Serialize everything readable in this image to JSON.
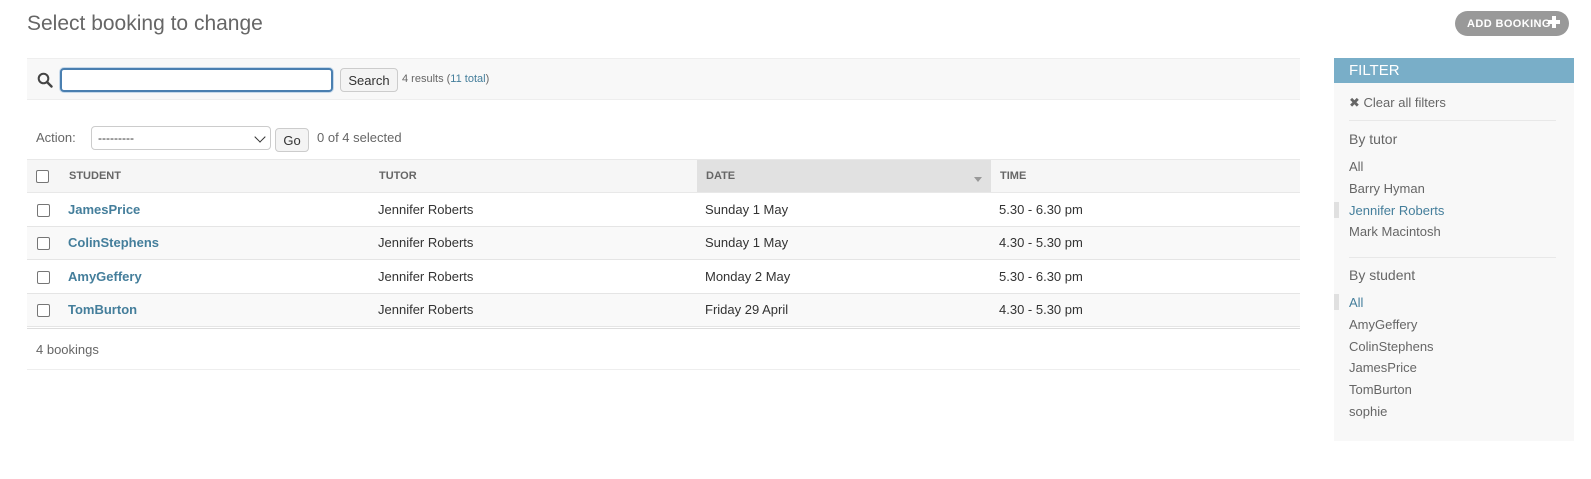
{
  "page": {
    "title": "Select booking to change",
    "add_button": "ADD BOOKING"
  },
  "search": {
    "value": "",
    "button": "Search",
    "results_prefix": "4 results (",
    "total_link": "11 total",
    "results_suffix": ")"
  },
  "actions": {
    "label": "Action:",
    "selected_option": "---------",
    "go_button": "Go",
    "selection_count": "0 of 4 selected"
  },
  "table": {
    "columns": [
      "STUDENT",
      "TUTOR",
      "DATE",
      "TIME"
    ],
    "sorted_column": "DATE",
    "rows": [
      {
        "student": "JamesPrice",
        "tutor": "Jennifer Roberts",
        "date": "Sunday 1 May",
        "time": "5.30 - 6.30 pm"
      },
      {
        "student": "ColinStephens",
        "tutor": "Jennifer Roberts",
        "date": "Sunday 1 May",
        "time": "4.30 - 5.30 pm"
      },
      {
        "student": "AmyGeffery",
        "tutor": "Jennifer Roberts",
        "date": "Monday 2 May",
        "time": "5.30 - 6.30 pm"
      },
      {
        "student": "TomBurton",
        "tutor": "Jennifer Roberts",
        "date": "Friday 29 April",
        "time": "4.30 - 5.30 pm"
      }
    ]
  },
  "paginator": "4 bookings",
  "filter": {
    "title": "FILTER",
    "clear_label": "Clear all filters",
    "tutor": {
      "title": "By tutor",
      "items": [
        "All",
        "Barry Hyman",
        "Jennifer Roberts",
        "Mark Macintosh"
      ],
      "selected": "Jennifer Roberts"
    },
    "student": {
      "title": "By student",
      "items": [
        "All",
        "AmyGeffery",
        "ColinStephens",
        "JamesPrice",
        "TomBurton",
        "sophie"
      ],
      "selected": "All"
    }
  },
  "colors": {
    "link": "#447e9b",
    "filter_header": "#79aec8",
    "add_button_bg": "#999999"
  },
  "icons": {
    "search": "search-icon",
    "add": "plus-icon",
    "clear": "close-icon",
    "sort": "sort-descending-icon"
  }
}
